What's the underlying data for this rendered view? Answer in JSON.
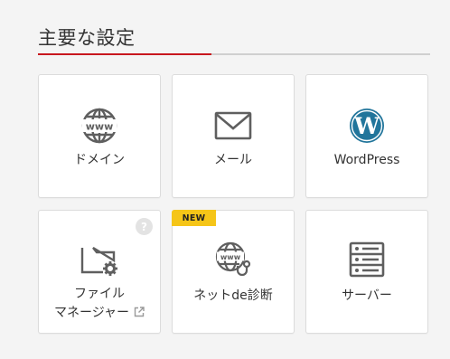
{
  "section": {
    "title": "主要な設定"
  },
  "colors": {
    "accent": "#c8171e",
    "badge_new": "#f5c518",
    "icon": "#5f5f5f",
    "wordpress": "#21759b"
  },
  "cards": [
    {
      "label": "ドメイン",
      "icon": "www-globe-icon"
    },
    {
      "label": "メール",
      "icon": "mail-icon"
    },
    {
      "label": "WordPress",
      "icon": "wordpress-icon"
    },
    {
      "label_line1": "ファイル",
      "label_line2": "マネージャー",
      "icon": "folder-gear-icon",
      "help": "?",
      "external": true
    },
    {
      "label": "ネットde診断",
      "icon": "globe-stethoscope-icon",
      "badge": "NEW"
    },
    {
      "label": "サーバー",
      "icon": "server-icon"
    }
  ]
}
